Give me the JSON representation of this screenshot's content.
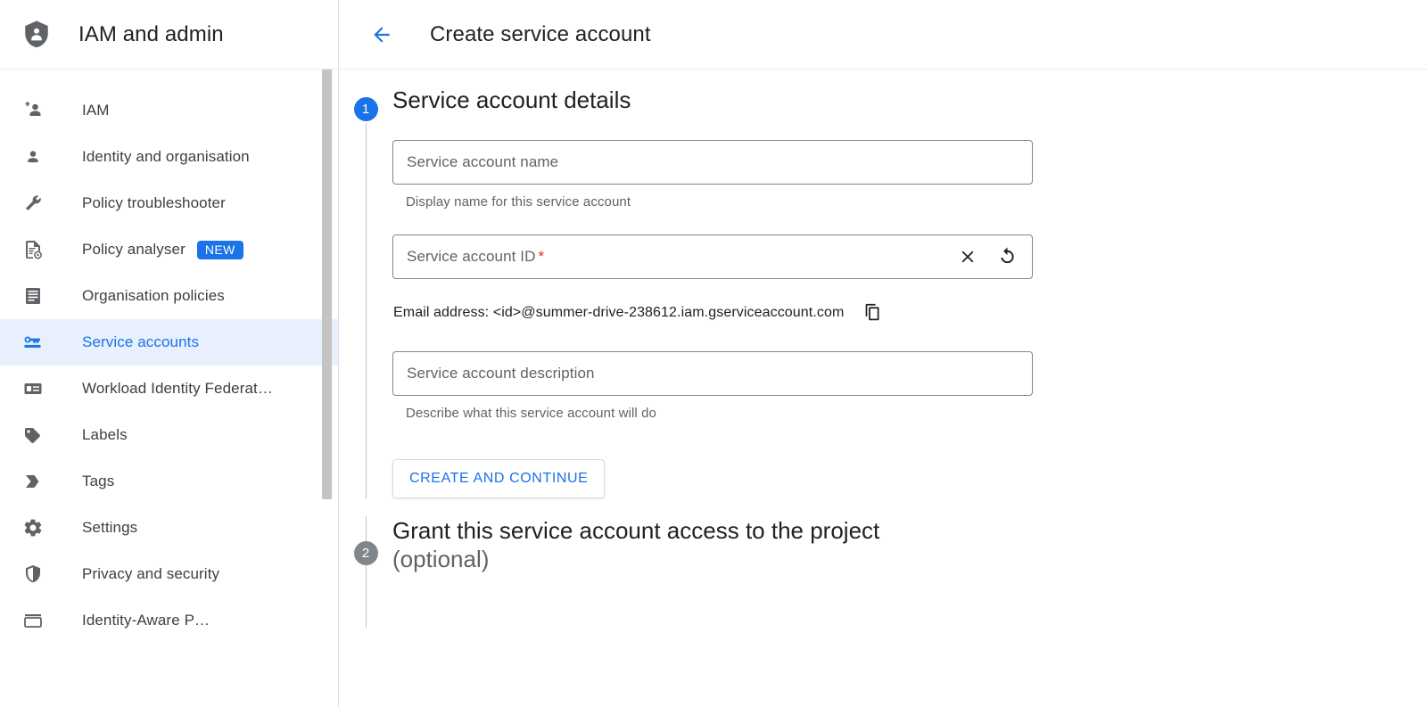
{
  "sidebar": {
    "brand": {
      "title": "IAM and admin",
      "icon": "shield-person-icon"
    },
    "items": [
      {
        "label": "IAM",
        "icon": "person-add-icon",
        "active": false
      },
      {
        "label": "Identity and organisation",
        "icon": "account-circle-icon",
        "active": false
      },
      {
        "label": "Policy troubleshooter",
        "icon": "wrench-icon",
        "active": false
      },
      {
        "label": "Policy analyser",
        "icon": "document-gear-icon",
        "active": false,
        "badge": "NEW"
      },
      {
        "label": "Organisation policies",
        "icon": "list-document-icon",
        "active": false
      },
      {
        "label": "Service accounts",
        "icon": "key-card-icon",
        "active": true
      },
      {
        "label": "Workload Identity Federat…",
        "icon": "id-card-icon",
        "active": false
      },
      {
        "label": "Labels",
        "icon": "label-tag-icon",
        "active": false
      },
      {
        "label": "Tags",
        "icon": "tag-chevron-icon",
        "active": false
      },
      {
        "label": "Settings",
        "icon": "gear-icon",
        "active": false
      },
      {
        "label": "Privacy and security",
        "icon": "shield-check-icon",
        "active": false
      },
      {
        "label": "Identity-Aware P…",
        "icon": "iap-icon",
        "active": false
      }
    ]
  },
  "header": {
    "back_icon": "arrow-back-icon",
    "title": "Create service account"
  },
  "steps": [
    {
      "number": "1",
      "state": "active",
      "heading": "Service account details"
    },
    {
      "number": "2",
      "state": "inactive",
      "heading": "Grant this service account access to the project",
      "optional": "(optional)"
    }
  ],
  "form": {
    "name_field": {
      "placeholder": "Service account name",
      "value": "",
      "hint": "Display name for this service account"
    },
    "id_field": {
      "placeholder": "Service account ID",
      "value": "",
      "required_marker": "*",
      "clear_icon": "close-icon",
      "refresh_icon": "refresh-icon"
    },
    "email": {
      "label": "Email address: <id>@summer-drive-238612.iam.gserviceaccount.com",
      "copy_icon": "content-copy-icon"
    },
    "description_field": {
      "placeholder": "Service account description",
      "value": "",
      "hint": "Describe what this service account will do"
    },
    "create_button": "CREATE AND CONTINUE"
  },
  "colors": {
    "accent": "#1a73e8",
    "active_row_bg": "#e8f0fe",
    "required": "#d93025",
    "icon_grey": "#5f6368",
    "inactive_step": "#80868b"
  }
}
